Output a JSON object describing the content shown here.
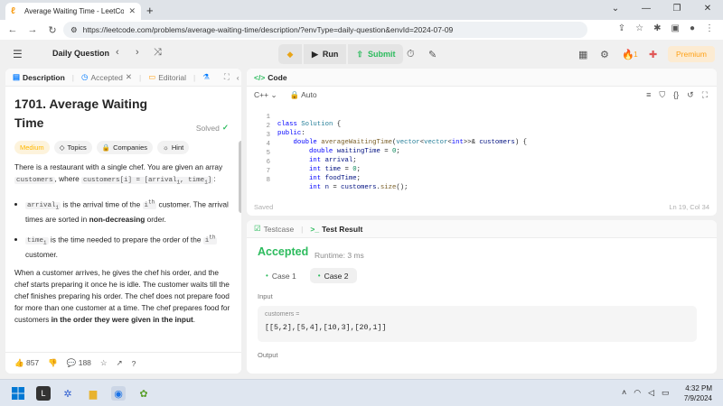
{
  "browser": {
    "tab_title": "Average Waiting Time - LeetCod",
    "url": "https://leetcode.com/problems/average-waiting-time/description/?envType=daily-question&envId=2024-07-09"
  },
  "toolbar": {
    "daily_question": "Daily Question",
    "run": "Run",
    "submit": "Submit",
    "streak": "1",
    "premium": "Premium"
  },
  "left": {
    "tabs": {
      "description": "Description",
      "accepted": "Accepted",
      "editorial": "Editorial"
    },
    "title": "1701. Average Waiting Time",
    "solved": "Solved",
    "tags": {
      "difficulty": "Medium",
      "topics": "Topics",
      "companies": "Companies",
      "hint": "Hint"
    },
    "intro_1": "There is a restaurant with a single chef. You are given an array ",
    "intro_code_1": "customers",
    "intro_2": ", where ",
    "intro_code_2": "customers[i] = [arrival",
    "intro_code_2b": "i",
    "intro_code_2c": ", time",
    "intro_code_2d": "i",
    "intro_code_2e": "]",
    "intro_3": ":",
    "b1_code": "arrival",
    "b1_code_sub": "i",
    "b1_text": " is the arrival time of the ",
    "b1_code2": "i",
    "b1_code2_sup": "th",
    "b1_text2": " customer. The arrival times are sorted in ",
    "b1_bold": "non-decreasing",
    "b1_end": " order.",
    "b2_code": "time",
    "b2_code_sub": "i",
    "b2_text": " is the time needed to prepare the order of the ",
    "b2_code2": "i",
    "b2_code2_sup": "th",
    "b2_end": " customer.",
    "para2": "When a customer arrives, he gives the chef his order, and the chef starts preparing it once he is idle. The customer waits till the chef finishes preparing his order. The chef does not prepare food for more than one customer at a time. The chef prepares food for customers ",
    "para2_bold": "in the order they were given in the input",
    "para2_end": ".",
    "likes": "857",
    "comments": "188"
  },
  "code": {
    "title": "Code",
    "language": "C++",
    "mode": "Auto",
    "saved": "Saved",
    "cursor": "Ln 19, Col 34",
    "lines": [
      {
        "n": "1",
        "t": "class Solution {"
      },
      {
        "n": "2",
        "t": "public:"
      },
      {
        "n": "3",
        "t": "    double averageWaitingTime(vector<vector<int>>& customers) {"
      },
      {
        "n": "4",
        "t": "        double waitingTime = 0;"
      },
      {
        "n": "5",
        "t": "        int arrival;"
      },
      {
        "n": "6",
        "t": "        int time = 0;"
      },
      {
        "n": "7",
        "t": "        int foodTime;"
      },
      {
        "n": "8",
        "t": "        int n = customers.size();"
      }
    ]
  },
  "result": {
    "tabs": {
      "testcase": "Testcase",
      "test_result": "Test Result"
    },
    "status": "Accepted",
    "runtime": "Runtime: 3 ms",
    "cases": [
      "Case 1",
      "Case 2"
    ],
    "input_label": "Input",
    "input_var": "customers =",
    "input_value": "[[5,2],[5,4],[10,3],[20,1]]",
    "output_label": "Output"
  },
  "taskbar": {
    "time": "4:32 PM",
    "date": "7/9/2024"
  },
  "colors": {
    "accent_green": "#2cbb5d",
    "leetcode_orange": "#ffa116",
    "medium_yellow": "#ffb800"
  }
}
